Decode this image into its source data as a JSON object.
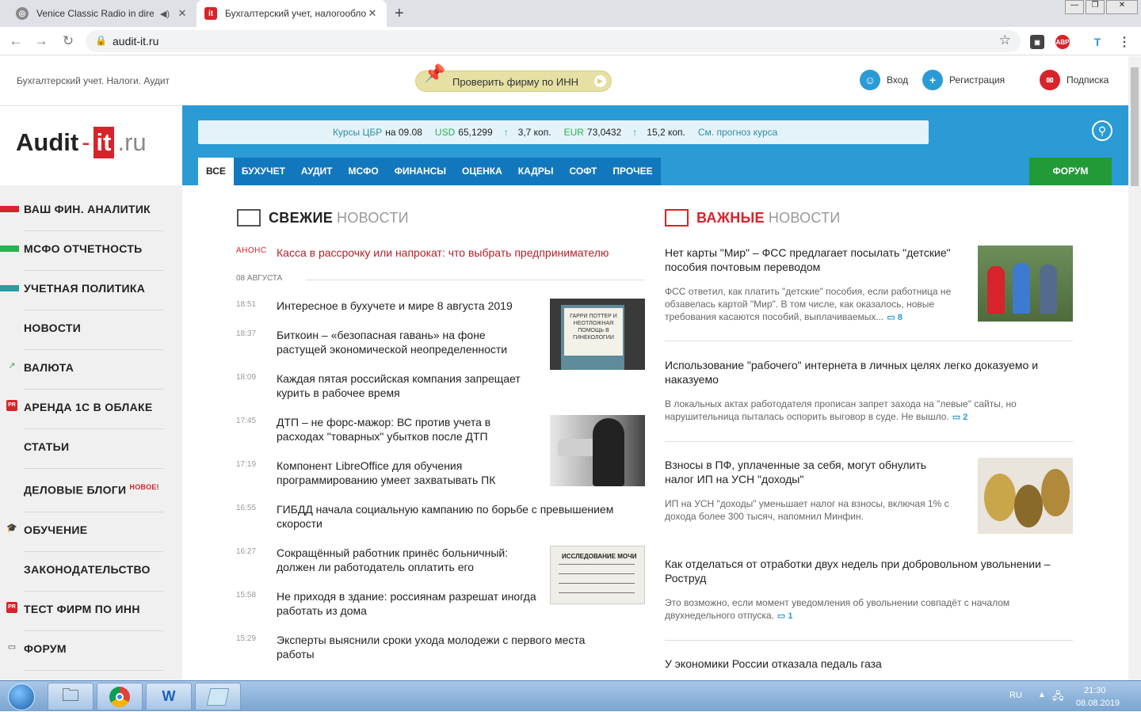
{
  "browser": {
    "tabs": [
      {
        "title": "Venice Classic Radio in diretta",
        "active": false
      },
      {
        "title": "Бухгалтерский учет, налогообложение",
        "active": true
      }
    ],
    "new_tab": "+",
    "url": "audit-it.ru",
    "window_controls": [
      "—",
      "❐",
      "✕"
    ]
  },
  "header": {
    "tagline": "Бухгалтерский учет. Налоги. Аудит",
    "inn_button": "Проверить фирму по ИНН",
    "login": "Вход",
    "register": "Регистрация",
    "subscribe": "Подписка"
  },
  "logo": {
    "part1": "Audit",
    "dash": "-",
    "part2": "it",
    "part3": ".ru"
  },
  "rates": {
    "label": "Курсы ЦБР",
    "date": "на 09.08",
    "usd_label": "USD",
    "usd_value": "65,1299",
    "usd_change": "3,7 коп.",
    "eur_label": "EUR",
    "eur_value": "73,0432",
    "eur_change": "15,2 коп.",
    "forecast": "См. прогноз курса",
    "arrow": "↑"
  },
  "nav": {
    "tabs": [
      "ВСЕ",
      "БУХУЧЕТ",
      "АУДИТ",
      "МСФО",
      "ФИНАНСЫ",
      "ОЦЕНКА",
      "КАДРЫ",
      "СОФТ",
      "ПРОЧЕЕ"
    ],
    "forum": "ФОРУМ"
  },
  "sidebar": {
    "items": [
      {
        "label": "ВАШ ФИН. АНАЛИТИК",
        "marker": "#d8232a"
      },
      {
        "label": "МСФО ОТЧЕТНОСТЬ",
        "marker": "#2db050"
      },
      {
        "label": "УЧЕТНАЯ ПОЛИТИКА",
        "marker": "#2a9ea0"
      },
      {
        "label": "НОВОСТИ",
        "marker": ""
      },
      {
        "label": "ВАЛЮТА",
        "icon": "chart-icon"
      },
      {
        "label": "АРЕНДА 1С В ОБЛАКЕ",
        "icon": "pr-icon"
      },
      {
        "label": "СТАТЬИ",
        "marker": ""
      },
      {
        "label": "ДЕЛОВЫЕ БЛОГИ",
        "badge": "НОВОЕ!"
      },
      {
        "label": "ОБУЧЕНИЕ",
        "icon": "graduation-cap-icon"
      },
      {
        "label": "ЗАКОНОДАТЕЛЬСТВО",
        "marker": ""
      },
      {
        "label": "ТЕСТ ФИРМ ПО ИНН",
        "icon": "pr-icon"
      },
      {
        "label": "ФОРУМ",
        "icon": "chat-icon"
      }
    ],
    "pr_text": "PR"
  },
  "fresh": {
    "title_bold": "СВЕЖИЕ",
    "title_light": "НОВОСТИ",
    "anons_tag": "АНОНС",
    "anons_text": "Касса в рассрочку или напрокат: что выбрать предпринимателю",
    "date": "08 АВГУСТА",
    "items": [
      {
        "time": "18:51",
        "title": "Интересное в бухучете и мире 8 августа 2019"
      },
      {
        "time": "18:37",
        "title": "Биткоин – «безопасная гавань» на фоне растущей экономической неопределенности"
      },
      {
        "time": "18:09",
        "title": "Каждая пятая российская компания запрещает курить в рабочее время"
      },
      {
        "time": "17:45",
        "title": "ДТП – не форс-мажор: ВС против учета в расходах \"товарных\" убытков после ДТП"
      },
      {
        "time": "17:19",
        "title": "Компонент LibreOffice для обучения программированию умеет захватывать ПК"
      },
      {
        "time": "16:55",
        "title": "ГИБДД начала социальную кампанию по борьбе с превышением скорости"
      },
      {
        "time": "16:27",
        "title": "Сокращённый работник принёс больничный: должен ли работодатель оплатить его"
      },
      {
        "time": "15:58",
        "title": "Не приходя в здание: россиянам разрешат иногда работать из дома"
      },
      {
        "time": "15:29",
        "title": "Эксперты выяснили сроки ухода молодежи с первого места работы"
      }
    ],
    "thumb1_text": "ГАРРИ ПОТТЕР И НЕОТЛОЖНАЯ ПОМОЩЬ В ГИНЕКОЛОГИИ",
    "thumb3_text": "ИССЛЕДОВАНИЕ МОЧИ"
  },
  "important": {
    "title_bold": "ВАЖНЫЕ",
    "title_light": "НОВОСТИ",
    "items": [
      {
        "title": "Нет карты \"Мир\" – ФСС предлагает посылать \"детские\" пособия почтовым переводом",
        "desc": "ФСС ответил, как платить \"детские\" пособия, если работница не обзавелась картой \"Мир\". В том числе, как оказалось, новые требования касаются пособий, выплачиваемых...",
        "comments": "8"
      },
      {
        "title": "Использование \"рабочего\" интернета в личных целях легко доказуемо и наказуемо",
        "desc": "В локальных актах работодателя прописан запрет захода на \"левые\" сайты, но нарушительница пыталась оспорить выговор в суде. Не вышло.",
        "comments": "2"
      },
      {
        "title": "Взносы в ПФ, уплаченные за себя, могут обнулить налог ИП на УСН \"доходы\"",
        "desc": "ИП на УСН \"доходы\" уменьшает налог на взносы, включая 1% с дохода более 300 тысяч, напомнил Минфин.",
        "comments": ""
      },
      {
        "title": "Как отделаться от отработки двух недель при добровольном увольнении – Роструд",
        "desc": "Это возможно, если момент уведомления об увольнении совпадёт с началом двухнедельного отпуска.",
        "comments": "1"
      },
      {
        "title": "У экономики России отказала педаль газа",
        "desc": "",
        "comments": ""
      }
    ]
  },
  "taskbar": {
    "lang": "RU",
    "time": "21:30",
    "date": "08.08.2019"
  },
  "colors": {
    "brand_red": "#d8232a",
    "brand_blue": "#2b9bd5",
    "forum_green": "#229a37"
  }
}
